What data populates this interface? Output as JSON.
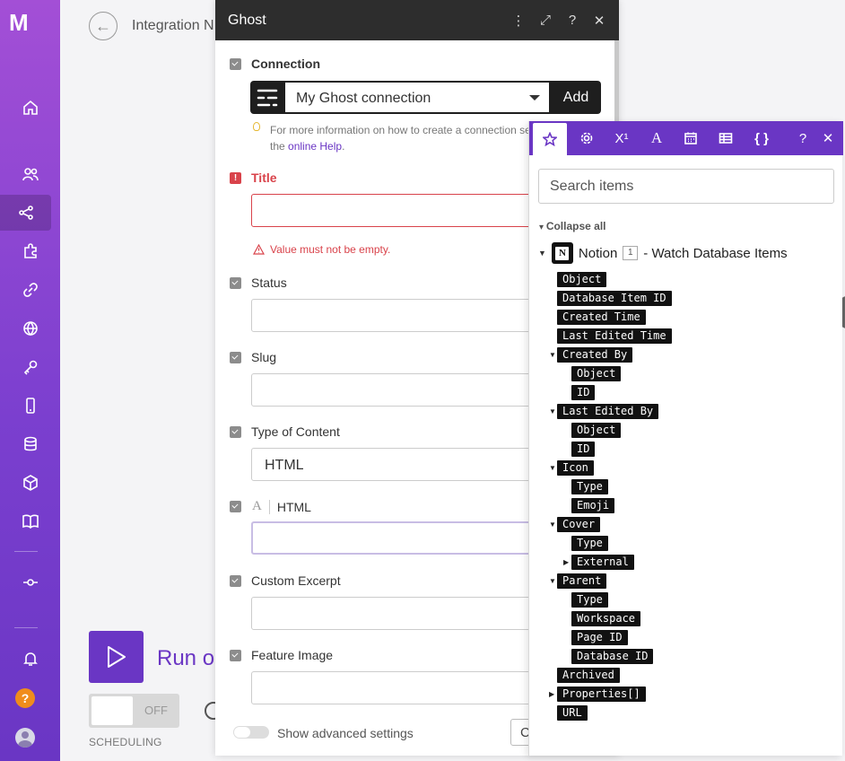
{
  "app": {
    "logo": "M",
    "page_title": "Integration N",
    "run_label": "Run o",
    "toggle_label": "OFF",
    "scheduling_label": "SCHEDULING"
  },
  "nav": [
    "home-icon",
    "team-icon",
    "scenarios-icon",
    "apps-icon",
    "connections-icon",
    "webhooks-icon",
    "keys-icon",
    "devices-icon",
    "datastores-icon",
    "datastructures-icon",
    "docs-icon",
    "flow-icon",
    "notifications-icon"
  ],
  "ghost": {
    "title": "Ghost",
    "connection_label": "Connection",
    "connection_value": "My Ghost connection",
    "add_label": "Add",
    "hint_text": "For more information on how to create a connection see the ",
    "hint_link": "online Help",
    "hint_end": ".",
    "title_label": "Title",
    "title_error": "Value must not be empty.",
    "status_label": "Status",
    "slug_label": "Slug",
    "type_label": "Type of Content",
    "type_value": "HTML",
    "html_label": "HTML",
    "excerpt_label": "Custom Excerpt",
    "feature_label": "Feature Image",
    "advanced_label": "Show advanced settings",
    "footer_button": "C"
  },
  "mapper": {
    "search_placeholder": "Search items",
    "collapse_label": "Collapse all",
    "module_name": "Notion",
    "module_number": "1",
    "module_action": "- Watch Database Items",
    "tags": [
      "Object",
      "Database Item ID",
      "Created Time",
      "Last Edited Time",
      "Created By",
      "Object",
      "ID",
      "Last Edited By",
      "Object",
      "ID",
      "Icon",
      "Type",
      "Emoji",
      "Cover",
      "Type",
      "External",
      "Parent",
      "Type",
      "Workspace",
      "Page ID",
      "Database ID",
      "Archived",
      "Properties[]",
      "URL"
    ]
  },
  "colors": {
    "accent": "#6a36c4",
    "error": "#d9434b",
    "header_dark": "#2d2d2d"
  }
}
